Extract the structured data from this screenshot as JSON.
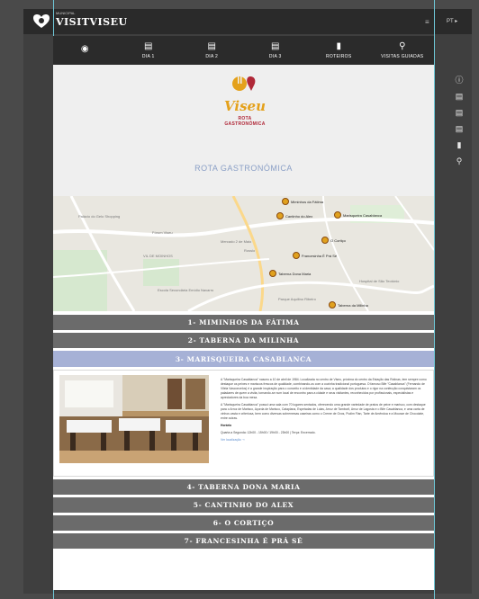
{
  "topbar": {
    "brand_small": "MUNICIPAL",
    "brand": "VISITVISEU",
    "brand_suffix": "PT",
    "menu_icon": "hamburger-icon",
    "lang": "PT ▸"
  },
  "nav": {
    "items": [
      {
        "label": "",
        "icon": "compass-icon"
      },
      {
        "label": "DIA 1",
        "icon": "calendar-icon"
      },
      {
        "label": "DIA 2",
        "icon": "calendar-icon"
      },
      {
        "label": "DIA 3",
        "icon": "calendar-icon"
      },
      {
        "label": "ROTEIROS",
        "icon": "bottle-icon"
      },
      {
        "label": "VISITAS GUIADAS",
        "icon": "guide-icon"
      }
    ]
  },
  "hero": {
    "logo_word": "Viseu",
    "logo_sub": "ROTA GASTRONÓMICA",
    "title": "ROTA GASTRONÓMICA"
  },
  "map": {
    "pins": [
      {
        "label": "Miminhos da Fátima"
      },
      {
        "label": "Cantinho do Alex"
      },
      {
        "label": "Marisqueira Casablanca"
      },
      {
        "label": "O Cortiço"
      },
      {
        "label": "Francesinha É Prá Sé"
      },
      {
        "label": "Taberna Dona Maria"
      },
      {
        "label": "Taberna da Milinha"
      }
    ],
    "places": [
      "Palácio do Gelo Shopping",
      "Fórum Viseu",
      "Rossio",
      "VIL DE MOINHOS",
      "Hospital de São Teotónio",
      "Mercado 2 de Maio",
      "Escola Secundária Emídio Navarro",
      "Parque Aquilino Ribeiro"
    ]
  },
  "accordion": {
    "items": [
      {
        "label": "1- MIMINHOS DA FÁTIMA",
        "active": false
      },
      {
        "label": "2- TABERNA DA MILINHA",
        "active": false
      },
      {
        "label": "3- MARISQUEIRA CASABLANCA",
        "active": true
      },
      {
        "label": "4- TABERNA DONA MARIA",
        "active": false
      },
      {
        "label": "5- CANTINHO DO ALEX",
        "active": false
      },
      {
        "label": "6- O CORTIÇO",
        "active": false
      },
      {
        "label": "7- FRANCESINHA É PRÁ SÉ",
        "active": false
      }
    ],
    "panel": {
      "p1": "A \"Marisqueira Casablanca\" nasceu a 10 de abril de 1984. Localizada no centro de Viseu, próxima do centro da Estação das Rotinas, tem sempre como destaque os peixes e mariscos frescos de qualidade, combinando-os com a cozinha tradicional portuguesa. O famoso Bife \"Casablanca\" (Fernando de Vilela Vasconcelos) é a grande inspiração para o conceito e a identidade da casa; a qualidade dos produtos e o rigor na confecção conquistaram os paladares de quem a visita, tornando-se num local de encontro para a cidade e seus visitantes, reconhecidos por profissionais, especialistas e apreciadores da boa mesa.",
      "p2": "A \"Marisqueira Casablanca\" possui uma sala com 70 lugares sentados, oferecendo uma grande variedade de pratos de peixe e marisco, com destaque para o Arroz de Marisco, Açorda de Marisco, Cataplana, Espetadas de Lulas, Arroz de Tamboril, Arroz de Lagosta e o Bife Casablanca, e uma carta de vinhos vasta e criteriosa, bem como diversas sobremesas caseiras como o Creme de Ovos, Pudim Flan, Tarte de Amêndoa e a Mousse de Chocolate, entre outras.",
      "hours_title": "Horário",
      "hours": "Quarta a Segunda: 12h00 - 15h00 / 19h00 - 23h00 | Terça: Encerrado.",
      "link": "Ver localização ⇢"
    }
  },
  "rail": {
    "icons": [
      "info-icon",
      "calendar-icon",
      "calendar-icon",
      "calendar-icon",
      "bottle-icon",
      "guide-icon"
    ]
  },
  "colors": {
    "accent_active": "#a6b1d6",
    "bar": "#6b6b6b",
    "nav_bg": "#2b2b2b",
    "logo_gold": "#e4a11b",
    "logo_red": "#b02838"
  }
}
